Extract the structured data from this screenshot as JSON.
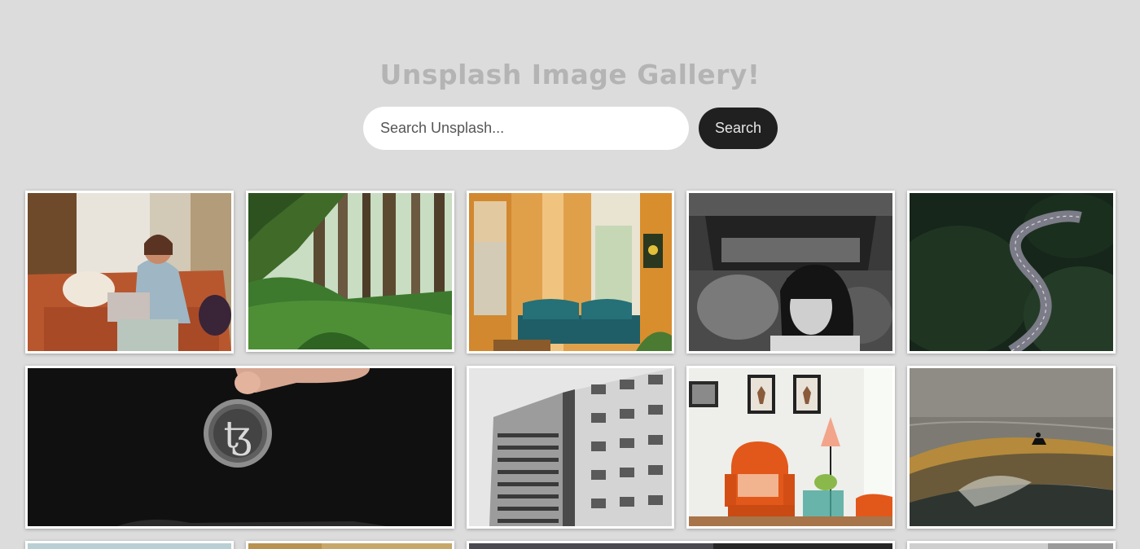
{
  "header": {
    "title": "Unsplash Image Gallery!"
  },
  "search": {
    "placeholder": "Search Unsplash...",
    "value": "",
    "button_label": "Search"
  },
  "colors": {
    "background": "#dcdcdc",
    "title": "#b4b4b4",
    "button_bg": "#202020",
    "button_text": "#e6e6e6"
  },
  "gallery": {
    "images": [
      {
        "subject": "woman-with-laptop-on-sofa"
      },
      {
        "subject": "fern-forest"
      },
      {
        "subject": "room-with-teal-sofa"
      },
      {
        "subject": "woman-in-hijab-black-and-white"
      },
      {
        "subject": "winding-road-aerial"
      },
      {
        "subject": "hand-holding-tezos-coin"
      },
      {
        "subject": "apartment-building-black-and-white"
      },
      {
        "subject": "orange-armchair-with-deer-prints"
      },
      {
        "subject": "surfer-on-wave"
      },
      {
        "subject": "partial-image"
      },
      {
        "subject": "partial-image"
      },
      {
        "subject": "partial-image"
      },
      {
        "subject": "partial-image"
      }
    ]
  }
}
